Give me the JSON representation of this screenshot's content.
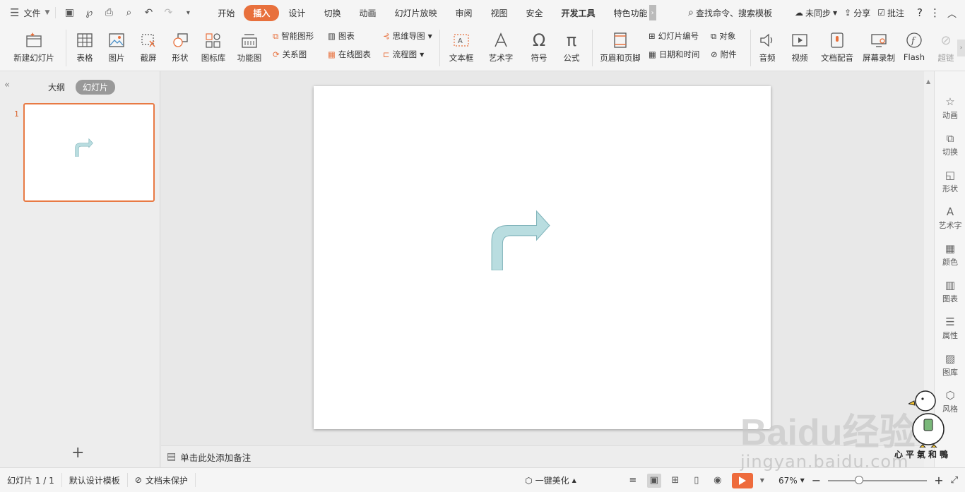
{
  "menubar": {
    "file_label": "文件",
    "tabs": [
      "开始",
      "插入",
      "设计",
      "切换",
      "动画",
      "幻灯片放映",
      "审阅",
      "视图",
      "安全",
      "开发工具",
      "特色功能"
    ],
    "active_tab": "插入",
    "search_label": "查找命令、搜索模板",
    "sync_label": "未同步",
    "share_label": "分享",
    "comment_label": "批注"
  },
  "ribbon": {
    "new_slide": "新建幻灯片",
    "table": "表格",
    "picture": "图片",
    "screenshot": "截屏",
    "shape": "形状",
    "icon_lib": "图标库",
    "func_chart": "功能图",
    "smart_art": "智能图形",
    "relation": "关系图",
    "chart": "图表",
    "online_chart": "在线图表",
    "mindmap": "思维导图",
    "flowchart": "流程图",
    "textbox": "文本框",
    "wordart": "艺术字",
    "symbol": "符号",
    "formula": "公式",
    "header_footer": "页眉和页脚",
    "slide_number": "幻灯片编号",
    "object": "对象",
    "datetime": "日期和时间",
    "attachment": "附件",
    "audio": "音频",
    "video": "视频",
    "dubbing": "文档配音",
    "screen_rec": "屏幕录制",
    "flash": "Flash",
    "hyperlink": "超链"
  },
  "leftpanel": {
    "outline_tab": "大纲",
    "slides_tab": "幻灯片",
    "slide_number": "1"
  },
  "notes_placeholder": "单击此处添加备注",
  "rightbar": [
    "动画",
    "切换",
    "形状",
    "艺术字",
    "颜色",
    "图表",
    "属性",
    "图库",
    "风格"
  ],
  "status": {
    "slide_info": "幻灯片 1 / 1",
    "template": "默认设计模板",
    "protection": "文档未保护",
    "beautify": "一键美化",
    "zoom": "67%"
  },
  "watermark": {
    "logo": "Baidu经验",
    "url": "jingyan.baidu.com",
    "signature": "心平氣和鴨"
  },
  "colors": {
    "accent": "#e8703c",
    "arrow_fill": "#b9dde0",
    "arrow_stroke": "#7fb3ba"
  }
}
